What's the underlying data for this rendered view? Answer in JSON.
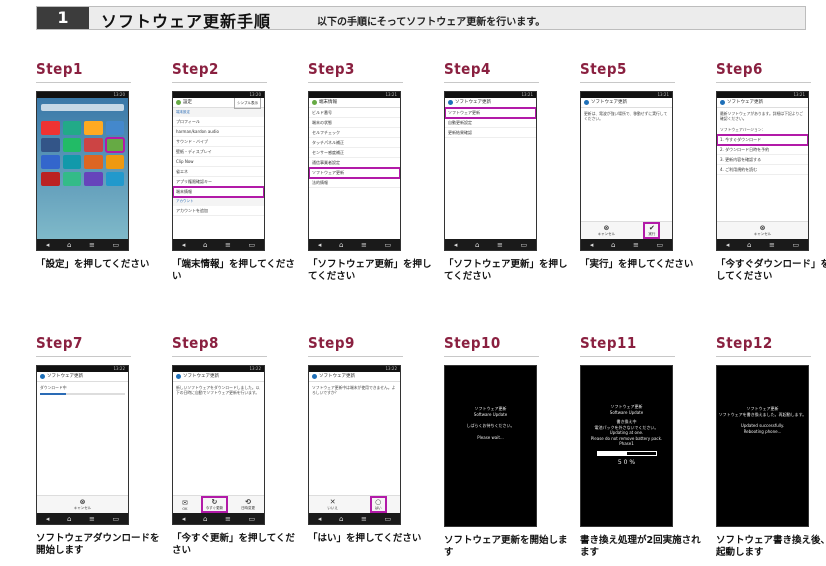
{
  "header": {
    "number": "1",
    "title": "ソフトウェア更新手順",
    "subtitle": "以下の手順にそってソフトウェア更新を行います。"
  },
  "colors": {
    "step_label": "#8a2040",
    "highlight": "#b21aa8",
    "header_bg": "#3c3c3c"
  },
  "status_time": [
    "13:20",
    "13:20",
    "13:21",
    "13:21",
    "13:21",
    "13:21",
    "13:22",
    "13:22",
    "13:22"
  ],
  "nav_icons": [
    "back-arrow-icon",
    "home-icon",
    "menu-icon",
    "recent-apps-icon"
  ],
  "steps": [
    {
      "label": "Step1",
      "caption": "「設定」を押してください"
    },
    {
      "label": "Step2",
      "caption": "「端末情報」を押してください"
    },
    {
      "label": "Step3",
      "caption": "「ソフトウェア更新」を押してください"
    },
    {
      "label": "Step4",
      "caption": "「ソフトウェア更新」を押してください"
    },
    {
      "label": "Step5",
      "caption": "「実行」を押してください"
    },
    {
      "label": "Step6",
      "caption": "「今すぐダウンロード」を押してください"
    },
    {
      "label": "Step7",
      "caption": "ソフトウェアダウンロードを開始します"
    },
    {
      "label": "Step8",
      "caption": "「今すぐ更新」を押してください"
    },
    {
      "label": "Step9",
      "caption": "「はい」を押してください"
    },
    {
      "label": "Step10",
      "caption": "ソフトウェア更新を開始します"
    },
    {
      "label": "Step11",
      "caption": "書き換え処理が2回実施されます"
    },
    {
      "label": "Step12",
      "caption": "ソフトウェア書き換え後、再起動します"
    }
  ],
  "s2": {
    "title": "設定",
    "tab": "シンプル表示",
    "section": "端末設定",
    "items": [
      "プロフィール",
      "harman/kardon audio",
      "サウンド・バイブ",
      "壁紙・ディスプレイ",
      "Clip Now",
      "省エネ",
      "アプリ権限確認キー",
      "端末情報"
    ],
    "section2": "アカウント",
    "acct": "アカウントを追加"
  },
  "s3": {
    "title": "端末情報",
    "items": [
      "ビルド番号",
      "端末の状態",
      "セルフチェック",
      "タッチパネル補正",
      "センサー感度補正",
      "通信事業者設定",
      "ソフトウェア更新",
      "法的情報"
    ]
  },
  "s4": {
    "title": "ソフトウェア更新",
    "items": [
      "ソフトウェア更新",
      "自動更新設定",
      "更新結果確認"
    ]
  },
  "s5": {
    "title": "ソフトウェア更新",
    "body": "更新は、電波が強い場所で、移動せずに実行してください。",
    "cancel": "キャンセル",
    "run": "実行"
  },
  "s6": {
    "title": "ソフトウェア更新",
    "body": "最新ソフトウェアがあります。詳細は下記よりご確認ください。",
    "ver": "ソフトウェアバージョン：",
    "items": [
      "1. 今すぐダウンロード",
      "2. ダウンロード日時を予約",
      "3. 更新内容を確認する",
      "4. ご利用規約を読む"
    ],
    "cancel": "キャンセル"
  },
  "s7": {
    "title": "ソフトウェア更新",
    "body": "ダウンロード中",
    "cancel": "キャンセル"
  },
  "s8": {
    "title": "ソフトウェア更新",
    "body": "新しいソフトウェアをダウンロードしました。以下の日時に自動でソフトウェア更新を行います。",
    "ok": "OK",
    "now": "今すぐ更新",
    "later": "日時変更"
  },
  "s9": {
    "title": "ソフトウェア更新",
    "body": "ソフトウェア更新中は端末が使用できません。よろしいですか？",
    "no": "いいえ",
    "yes": "はい"
  },
  "s10": {
    "l1": "ソフトウェア更新",
    "l2": "Software Update",
    "l3": "しばらくお待ちください。",
    "l4": "Please wait..."
  },
  "s11": {
    "l1": "ソフトウェア更新",
    "l2": "Software Update",
    "l3": "書き換え中",
    "l4": "電池パックを外さないでください。",
    "l5": "Updating at one.",
    "l6": "Please do not remove battery pack.",
    "l7": "Phase1",
    "pct": "5 0 %",
    "progress": 0.5
  },
  "s12": {
    "l1": "ソフトウェア更新",
    "l2": "ソフトウェアを書き換えました。再起動します。",
    "l3": "Updated successfully.",
    "l4": "Rebooting phone..."
  }
}
